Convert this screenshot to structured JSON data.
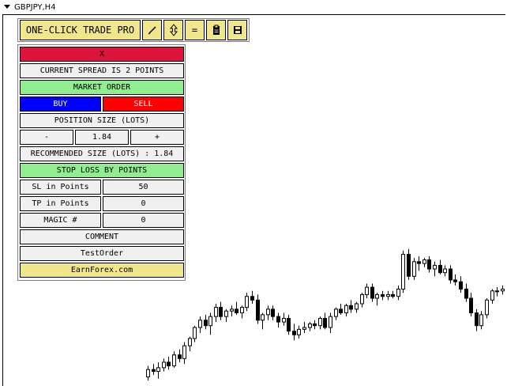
{
  "window": {
    "symbol_title": "GBPJPY,H4"
  },
  "toolbar": {
    "title_button": "ONE-CLICK TRADE PRO",
    "pencil_icon": "pencil-icon",
    "updown_icon": "up-down-arrow-icon",
    "equals_label": "=",
    "clipboard_icon": "clipboard-icon",
    "save_icon": "save-icon"
  },
  "panel": {
    "close_label": "X",
    "spread_text": "CURRENT SPREAD IS 2 POINTS",
    "market_order_label": "MARKET ORDER",
    "buy_label": "BUY",
    "sell_label": "SELL",
    "position_size_label": "POSITION SIZE (LOTS)",
    "minus_label": "-",
    "lots_value": "1.84",
    "plus_label": "+",
    "recommended_text": "RECOMMENDED SIZE (LOTS) : 1.84",
    "stop_loss_label": "STOP LOSS BY POINTS",
    "sl_label": "SL in Points",
    "sl_value": "50",
    "tp_label": "TP in Points",
    "tp_value": "0",
    "magic_label": "MAGIC #",
    "magic_value": "0",
    "comment_label": "COMMENT",
    "comment_value": "TestOrder",
    "link_label": "EarnForex.com"
  },
  "colors": {
    "close": "#dc143c",
    "green": "#90ee90",
    "buy": "#0000ff",
    "sell": "#ff0000",
    "yellow": "#f0e68c",
    "field": "#f0f0f0",
    "candle": "#000000"
  },
  "chart_data": {
    "type": "candlestick",
    "ohlc": [
      [
        165.3,
        165.9,
        165.1,
        165.7
      ],
      [
        165.7,
        166.0,
        165.4,
        165.6
      ],
      [
        165.6,
        166.1,
        165.2,
        165.8
      ],
      [
        165.8,
        166.3,
        165.6,
        166.1
      ],
      [
        166.1,
        166.4,
        165.7,
        165.9
      ],
      [
        165.9,
        166.7,
        165.8,
        166.5
      ],
      [
        166.5,
        166.8,
        166.1,
        166.3
      ],
      [
        166.3,
        167.2,
        166.0,
        167.0
      ],
      [
        167.0,
        167.5,
        166.7,
        167.4
      ],
      [
        167.4,
        168.1,
        167.2,
        168.0
      ],
      [
        168.0,
        168.6,
        167.7,
        168.4
      ],
      [
        168.4,
        168.7,
        167.9,
        168.1
      ],
      [
        168.1,
        168.8,
        167.6,
        168.6
      ],
      [
        168.6,
        169.3,
        168.3,
        169.1
      ],
      [
        169.1,
        169.4,
        168.4,
        168.6
      ],
      [
        168.6,
        169.0,
        168.3,
        168.9
      ],
      [
        168.9,
        169.2,
        168.6,
        169.0
      ],
      [
        169.0,
        169.4,
        168.7,
        168.8
      ],
      [
        168.8,
        169.2,
        168.5,
        169.1
      ],
      [
        169.1,
        169.9,
        168.9,
        169.7
      ],
      [
        169.7,
        170.0,
        169.3,
        169.5
      ],
      [
        169.5,
        169.8,
        168.2,
        168.4
      ],
      [
        168.4,
        168.8,
        167.9,
        168.7
      ],
      [
        168.7,
        169.2,
        168.4,
        169.0
      ],
      [
        169.0,
        169.2,
        168.4,
        168.6
      ],
      [
        168.6,
        168.8,
        168.0,
        168.3
      ],
      [
        168.3,
        168.8,
        168.1,
        168.5
      ],
      [
        168.5,
        168.7,
        167.6,
        167.8
      ],
      [
        167.8,
        168.2,
        167.3,
        167.6
      ],
      [
        167.6,
        168.1,
        167.4,
        167.9
      ],
      [
        167.9,
        168.3,
        167.7,
        168.0
      ],
      [
        168.0,
        168.3,
        167.8,
        168.2
      ],
      [
        168.2,
        168.4,
        167.9,
        168.1
      ],
      [
        168.1,
        168.6,
        167.9,
        168.5
      ],
      [
        168.5,
        168.8,
        167.9,
        168.0
      ],
      [
        168.0,
        168.8,
        167.7,
        168.6
      ],
      [
        168.6,
        169.1,
        168.4,
        169.0
      ],
      [
        169.0,
        169.3,
        168.7,
        168.8
      ],
      [
        168.8,
        169.3,
        168.6,
        169.2
      ],
      [
        169.2,
        169.5,
        168.8,
        169.0
      ],
      [
        169.0,
        169.4,
        168.8,
        169.3
      ],
      [
        169.3,
        169.9,
        169.1,
        169.8
      ],
      [
        169.8,
        170.4,
        169.6,
        170.2
      ],
      [
        170.2,
        170.4,
        169.4,
        169.6
      ],
      [
        169.6,
        169.9,
        169.2,
        169.8
      ],
      [
        169.8,
        170.0,
        169.5,
        169.7
      ],
      [
        169.7,
        170.0,
        169.5,
        169.8
      ],
      [
        169.8,
        170.0,
        169.6,
        169.7
      ],
      [
        169.7,
        170.3,
        169.5,
        170.1
      ],
      [
        170.1,
        172.2,
        169.9,
        172.0
      ],
      [
        172.0,
        172.3,
        170.6,
        170.8
      ],
      [
        170.8,
        171.8,
        170.6,
        171.6
      ],
      [
        171.6,
        171.9,
        171.1,
        171.5
      ],
      [
        171.5,
        171.8,
        171.3,
        171.7
      ],
      [
        171.7,
        171.9,
        171.0,
        171.2
      ],
      [
        171.2,
        171.6,
        170.8,
        171.4
      ],
      [
        171.4,
        171.7,
        170.9,
        171.0
      ],
      [
        171.0,
        171.4,
        170.8,
        171.2
      ],
      [
        171.2,
        171.4,
        170.4,
        170.6
      ],
      [
        170.6,
        170.9,
        170.3,
        170.5
      ],
      [
        170.5,
        170.8,
        169.9,
        170.1
      ],
      [
        170.1,
        170.4,
        169.4,
        169.6
      ],
      [
        169.6,
        169.9,
        168.6,
        168.8
      ],
      [
        168.8,
        169.0,
        167.8,
        168.1
      ],
      [
        168.1,
        168.9,
        167.9,
        168.7
      ],
      [
        168.7,
        169.6,
        168.5,
        169.5
      ],
      [
        169.5,
        170.1,
        169.3,
        170.0
      ],
      [
        170.0,
        170.2,
        169.7,
        170.0
      ],
      [
        170.0,
        170.3,
        169.8,
        170.1
      ]
    ]
  }
}
